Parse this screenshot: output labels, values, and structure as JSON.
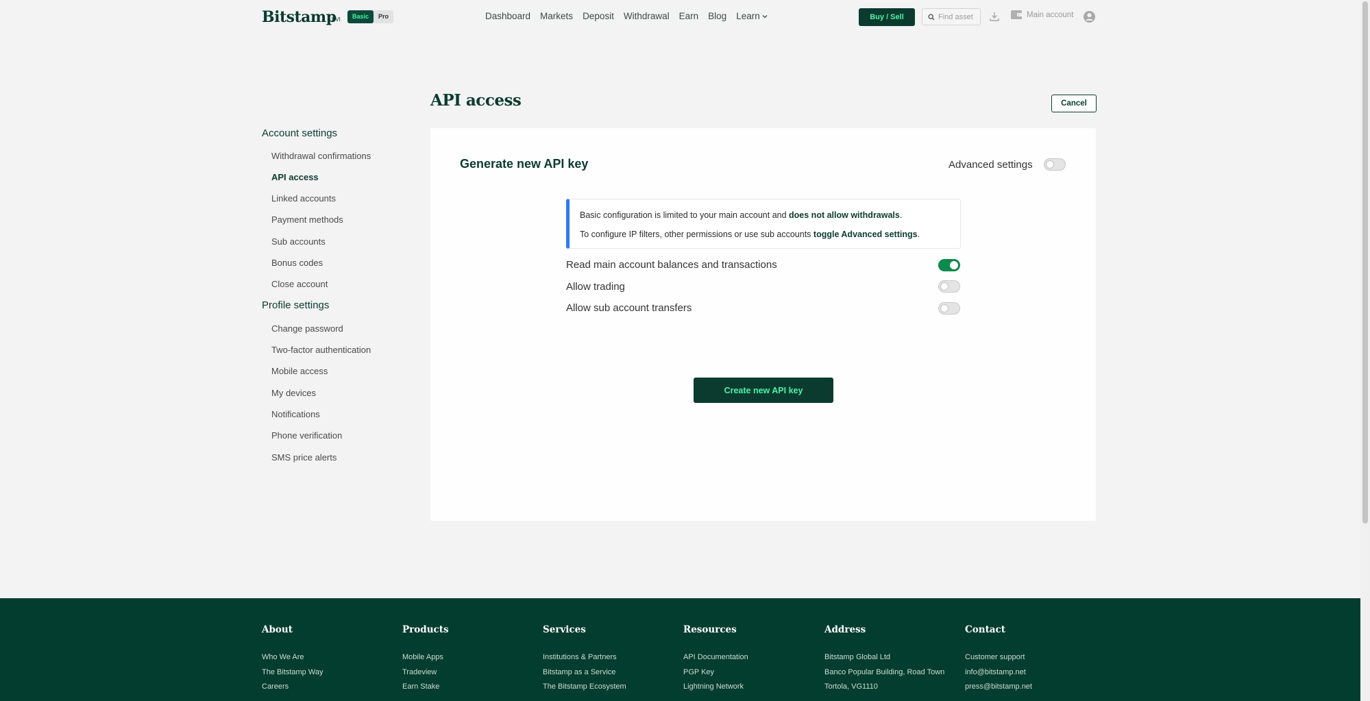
{
  "header": {
    "logo": "Bitstamp",
    "logo_suffix": "BVI",
    "plan_basic": "Basic",
    "plan_pro": "Pro",
    "nav": [
      "Dashboard",
      "Markets",
      "Deposit",
      "Withdrawal",
      "Earn",
      "Blog",
      "Learn"
    ],
    "buy_sell": "Buy / Sell",
    "find_asset_placeholder": "Find asset",
    "main_account": "Main account"
  },
  "sidebar": {
    "account_settings": {
      "title": "Account settings",
      "items": [
        "Withdrawal confirmations",
        "API access",
        "Linked accounts",
        "Payment methods",
        "Sub accounts",
        "Bonus codes",
        "Close account"
      ]
    },
    "profile_settings": {
      "title": "Profile settings",
      "items": [
        "Change password",
        "Two-factor authentication",
        "Mobile access",
        "My devices",
        "Notifications",
        "Phone verification",
        "SMS price alerts"
      ]
    },
    "active_item": "API access"
  },
  "main": {
    "title": "API access",
    "cancel": "Cancel",
    "card_title": "Generate new API key",
    "advanced_settings": "Advanced settings",
    "advanced_settings_on": false,
    "info": {
      "line1_prefix": "Basic configuration is limited to your main account and ",
      "line1_bold": "does not allow withdrawals",
      "line1_suffix": ".",
      "line2_prefix": "To configure IP filters, other permissions or use sub accounts ",
      "line2_bold": "toggle Advanced settings",
      "line2_suffix": "."
    },
    "permissions": [
      {
        "label": "Read main account balances and transactions",
        "enabled": true
      },
      {
        "label": "Allow trading",
        "enabled": false
      },
      {
        "label": "Allow sub account transfers",
        "enabled": false
      }
    ],
    "create_button": "Create new API key"
  },
  "footer": {
    "columns": [
      {
        "title": "About",
        "links": [
          "Who We Are",
          "The Bitstamp Way",
          "Careers"
        ]
      },
      {
        "title": "Products",
        "links": [
          "Mobile Apps",
          "Tradeview",
          "Earn Stake"
        ]
      },
      {
        "title": "Services",
        "links": [
          "Institutions & Partners",
          "Bitstamp as a Service",
          "The Bitstamp Ecosystem"
        ]
      },
      {
        "title": "Resources",
        "links": [
          "API Documentation",
          "PGP Key",
          "Lightning Network"
        ]
      },
      {
        "title": "Address",
        "links": [
          "Bitstamp Global Ltd",
          "Banco Popular Building, Road Town",
          "Tortola, VG1110"
        ]
      },
      {
        "title": "Contact",
        "links": [
          "Customer support",
          "info@bitstamp.net",
          "press@bitstamp.net"
        ]
      }
    ]
  },
  "colors": {
    "brand_dark": "#0b3b2e",
    "brand_accent": "#4ff0a8",
    "toggle_on": "#0d8a4d",
    "info_border": "#2e7bf0",
    "footer_bg": "#033d2f"
  }
}
